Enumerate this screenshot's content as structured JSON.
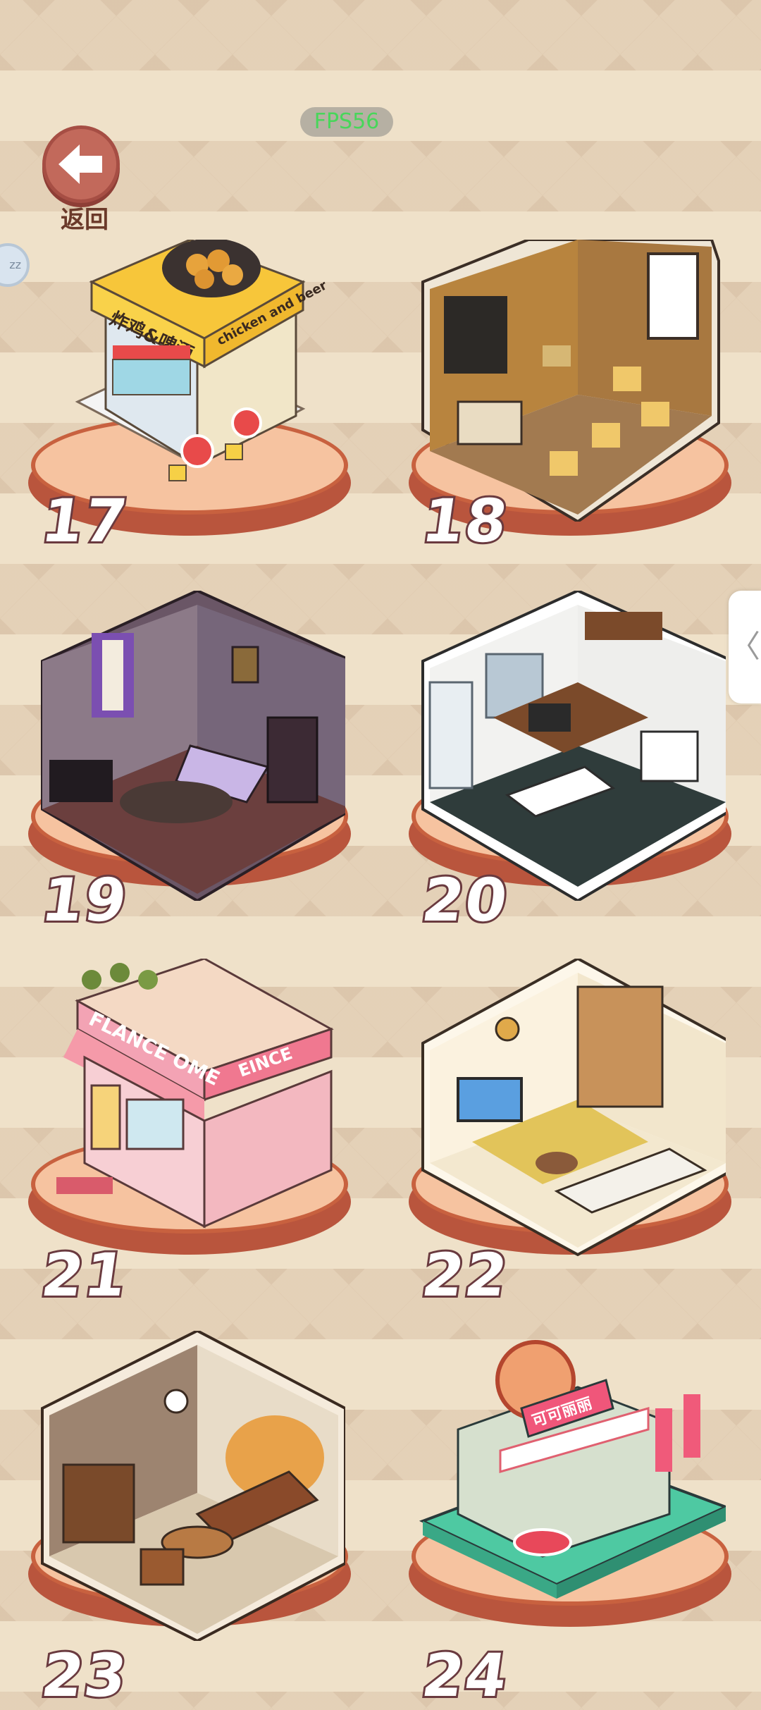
{
  "hud": {
    "fps": "FPS56"
  },
  "back": {
    "label": "返回"
  },
  "side": {
    "bubble": "zz",
    "tab_icon": "〈"
  },
  "levels": [
    {
      "number": "17",
      "theme": "chicken-beer-shop",
      "sign_cn": "炸鸡&啤酒",
      "sign_en": "chicken and beer"
    },
    {
      "number": "18",
      "theme": "cafe"
    },
    {
      "number": "19",
      "theme": "gothic-bedroom"
    },
    {
      "number": "20",
      "theme": "kitchen"
    },
    {
      "number": "21",
      "theme": "flower-shop",
      "sign_en": "FLANCE OME",
      "sign_side": "EINCE"
    },
    {
      "number": "22",
      "theme": "living-room"
    },
    {
      "number": "23",
      "theme": "retro-lounge"
    },
    {
      "number": "24",
      "theme": "food-truck",
      "sign_cn": "可可丽丽"
    }
  ],
  "colors": {
    "plate": "#f6c3a0",
    "plate_rim": "#c8613f",
    "number_stroke": "#6a3a3f",
    "back": "#c2695b"
  }
}
